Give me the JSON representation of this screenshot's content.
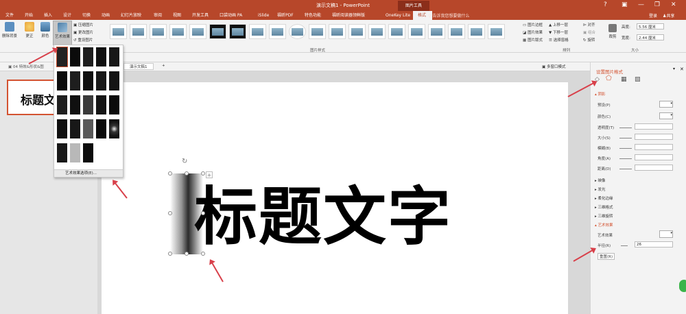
{
  "title": "演示文稿1 - PowerPoint",
  "window_controls": {
    "help": "?",
    "ribbon": "▣",
    "min": "—",
    "max": "❐",
    "close": "✕"
  },
  "tool_label": "图片工具",
  "tabs": [
    "文件",
    "开始",
    "插入",
    "设计",
    "切换",
    "动画",
    "幻灯片放映",
    "审阅",
    "视图",
    "开发工具",
    "口袋动画 PA",
    "iSlide",
    "福昕PDF",
    "特色功能",
    "福昕阅读器领鲜版",
    "OneKey Lite",
    "格式"
  ],
  "tell_me": "告诉我您想要做什么",
  "login": "登录",
  "share": "共享",
  "ribbon": {
    "remove_bg": "删除背景",
    "correct": "更正",
    "color": "颜色",
    "art_effect": "艺术效果",
    "compress": "压缩图片",
    "change": "更改图片",
    "reset": "重设图片",
    "pic_styles_group": "图片样式",
    "border": "图片边框",
    "effect": "图片效果",
    "layout": "图片版式",
    "forward": "上移一层",
    "backward": "下移一层",
    "select_pane": "选择窗格",
    "align": "对齐",
    "group": "组合",
    "rotate": "旋转",
    "arrange_group": "排列",
    "crop": "裁剪",
    "height_label": "高度:",
    "height_val": "5.56 厘米",
    "width_label": "宽度:",
    "width_val": "2.44 厘米",
    "size_group": "大小"
  },
  "doc_tabs": {
    "left": "04 特效&形状&图",
    "right": "演示文稿1",
    "multi": "多窗口模式"
  },
  "thumb_text": "标题文",
  "slide_title": "标题文字",
  "dropdown": {
    "options_label": "艺术效果选项(E)..."
  },
  "pane": {
    "title": "设置图片格式",
    "shadow": "阴影",
    "preset": "预设(P)",
    "color": "颜色(C)",
    "transparency": "透明度(T)",
    "size": "大小(S)",
    "blur": "模糊(B)",
    "angle": "角度(A)",
    "distance": "距离(D)",
    "reflection": "映像",
    "glow": "发光",
    "soft_edges": "柔化边缘",
    "3d_format": "三维格式",
    "3d_rotation": "三维旋转",
    "art_effects": "艺术效果",
    "art_effect_field": "艺术效果",
    "radius": "半径(R)",
    "radius_val": "26",
    "reset": "重置(R)"
  },
  "colors": {
    "accent": "#b7472a",
    "pane_red": "#d35230",
    "arrow": "#d8404a"
  }
}
